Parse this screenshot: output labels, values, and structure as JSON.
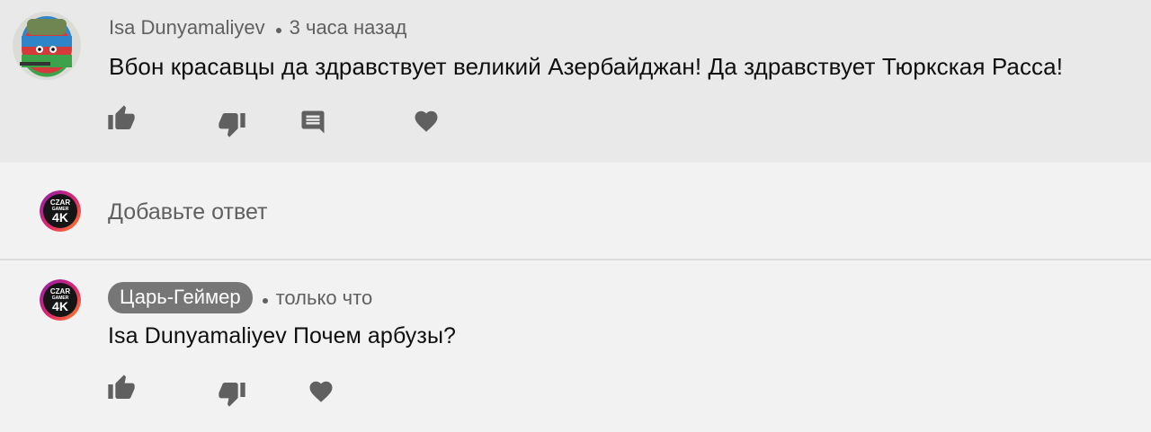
{
  "comment": {
    "author": "Isa Dunyamaliyev",
    "time": "3 часа назад",
    "text": "Вбон красавцы да здравствует великий Азербайджан! Да здравствует Тюркская Расса!",
    "avatar_icon": "flag-ball-avatar",
    "actions": [
      "like-icon",
      "dislike-icon",
      "reply-icon",
      "heart-icon"
    ]
  },
  "reply_box": {
    "placeholder": "Добавьте ответ",
    "avatar_icon": "czar-gamer-4k-avatar"
  },
  "reply": {
    "author": "Царь-Геймер",
    "time": "только что",
    "text": "Isa Dunyamaliyev Почем арбузы?",
    "avatar_icon": "czar-gamer-4k-avatar",
    "actions": [
      "like-icon",
      "dislike-icon",
      "heart-icon"
    ]
  },
  "avatar_text": {
    "line1": "CZAR",
    "line2": "GAMER",
    "line3": "4K"
  },
  "colors": {
    "top_bg": "#e9e9e9",
    "page_bg": "#f2f2f2",
    "meta_gray": "#606060",
    "icon_gray": "#606060",
    "badge_bg": "#767676"
  }
}
